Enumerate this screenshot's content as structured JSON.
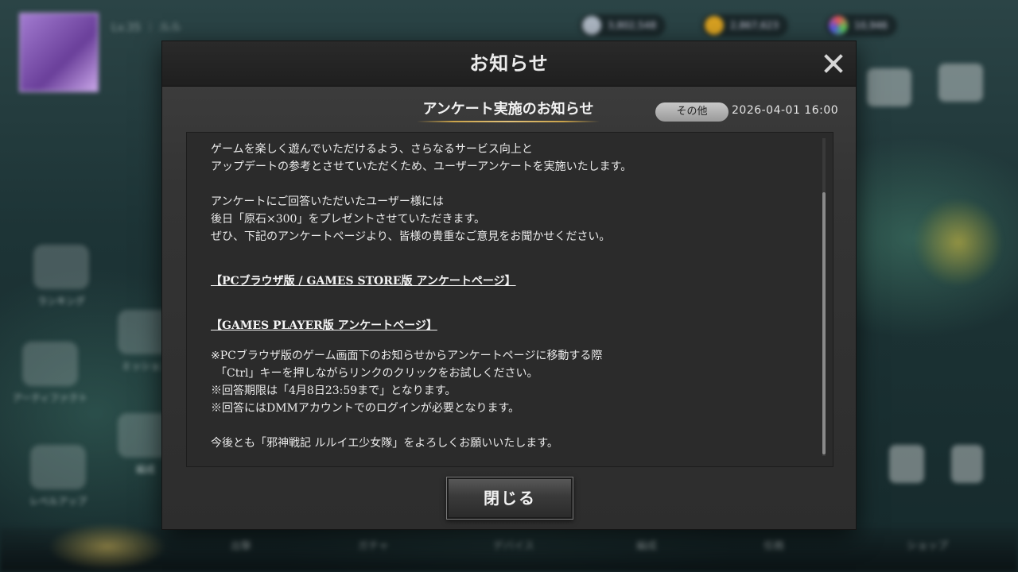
{
  "background": {
    "level_text": "Lv.35 ｜ ルル",
    "currencies": [
      "3,802,548",
      "2,867,623",
      "10,946"
    ],
    "side_menu": [
      "ランキング",
      "ミッション",
      "アーティファクト",
      "編成",
      "レベルアップ"
    ],
    "bottom_tabs": [
      "出撃",
      "ガチャ",
      "デバイス",
      "編成",
      "任務",
      "ショップ"
    ]
  },
  "dialog": {
    "title": "お知らせ",
    "close_button_label": "閉じる"
  },
  "notice": {
    "heading": "アンケート実施のお知らせ",
    "category": "その他",
    "date": "2026-04-01 16:00",
    "paragraph1": [
      "ゲームを楽しく遊んでいただけるよう、さらなるサービス向上と",
      "アップデートの参考とさせていただくため、ユーザーアンケートを実施いたします。"
    ],
    "paragraph2": [
      "アンケートにご回答いただいたユーザー様には",
      "後日「原石×300」をプレゼントさせていただきます。",
      "ぜひ、下記のアンケートページより、皆様の貴重なご意見をお聞かせください。"
    ],
    "link_pc": "【PCブラウザ版 / GAMES STORE版 アンケートページ】",
    "link_player": "【GAMES PLAYER版 アンケートページ】",
    "notes": [
      "※PCブラウザ版のゲーム画面下のお知らせからアンケートページに移動する際",
      "「Ctrl」キーを押しながらリンクのクリックをお試しください。",
      "※回答期限は「4月8日23:59まで」となります。",
      "※回答にはDMMアカウントでのログインが必要となります。"
    ],
    "closing": "今後とも「邪神戦記 ルルイエ少女隊」をよろしくお願いいたします。"
  },
  "colors": {
    "accent_gold": "#c9a24a",
    "dialog_bg": "#343434",
    "panel_bg": "#2b2b2b",
    "text": "#ebebeb"
  },
  "icons": [
    "close-icon",
    "coin-icon",
    "gem-icon"
  ]
}
